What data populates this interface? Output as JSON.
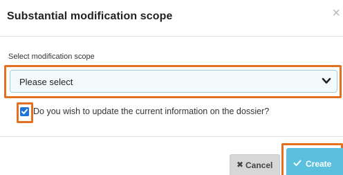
{
  "dialog": {
    "title": "Substantial modification scope",
    "close_glyph": "×"
  },
  "scope_field": {
    "label": "Select modification scope",
    "selected_value": "Please select",
    "icon": "chevron-down-icon"
  },
  "update_checkbox": {
    "checked": true,
    "label": "Do you wish to update the current information on the dossier?"
  },
  "footer": {
    "cancel_icon_glyph": "✖",
    "cancel_label": "Cancel",
    "create_icon": "check-icon",
    "create_label": "Create"
  },
  "colors": {
    "highlight": "#e2701e",
    "create_button": "#5bc0de",
    "cancel_button": "#d7d7d7",
    "checkbox": "#1e74d9",
    "select_border": "#a3cbd3"
  }
}
